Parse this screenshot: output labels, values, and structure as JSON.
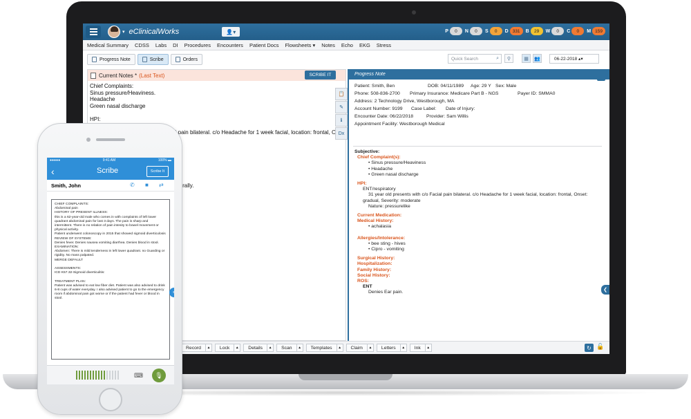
{
  "app": {
    "brand": "eClinicalWorks"
  },
  "counters": [
    {
      "label": "P",
      "value": "0",
      "color": "#d9d9d9"
    },
    {
      "label": "N",
      "value": "0",
      "color": "#d9d9d9"
    },
    {
      "label": "S",
      "value": "0",
      "color": "#f2a33a"
    },
    {
      "label": "D",
      "value": "331",
      "color": "#f07a33"
    },
    {
      "label": "B",
      "value": "29",
      "color": "#f1c232"
    },
    {
      "label": "W",
      "value": "0",
      "color": "#d9d9d9"
    },
    {
      "label": "C",
      "value": "0",
      "color": "#f07a33"
    },
    {
      "label": "M",
      "value": "159",
      "color": "#f07a33"
    }
  ],
  "nav": [
    "Medical Summary",
    "CDSS",
    "Labs",
    "DI",
    "Procedures",
    "Encounters",
    "Patient Docs",
    "Flowsheets ▾",
    "Notes",
    "Echo",
    "EKG",
    "Stress"
  ],
  "toolbar": {
    "progress_note": "Progress Note",
    "scribe": "Scribe",
    "orders": "Orders",
    "search_placeholder": "Quick Search",
    "date": "06-22-2018 ▴▾"
  },
  "current_notes": {
    "title": "Current Notes *",
    "status": "(Last Text)",
    "scribe_button": "SCRIBE IT",
    "text": "Chief Complaints:\nSinus pressure/Heaviness.\nHeadache\nGreen nasal discharge\n\nHPI:\nENT/Respiratory:\n31 year old presents with c/o Facial pain bilateral. c/o Headache for 1 week facial, location: frontal, Ons\n\n\nthroat.\n\n\n\n\nly, tympanic membranes normal bilaterally.\n\n\nterally."
  },
  "side_tools": [
    "📋",
    "✎",
    "ℹ",
    "Dx"
  ],
  "progress_note": {
    "header": "Progress Note",
    "patient": "Patient: Smith, Ben",
    "dob": "DOB: 04/11/1989",
    "age": "Age: 29 Y",
    "sex": "Sex: Male",
    "phone": "Phone: 508-836-2700",
    "insurance": "Primary Insurance: Medicare Part B - NGS",
    "payer": "Payer ID: SMMA0",
    "address": "Address: 2 Technology Drive, Westborough, MA",
    "account": "Account Number: 9199",
    "case_label": "Case Label:",
    "date_of_injury": "Date of Injury:",
    "encounter_date": "Encounter Date: 06/22/2018",
    "provider": "Provider: Sam Willis",
    "facility": "Appointment Facility: Westborough Medical",
    "subjective": "Subjective:",
    "chief_complaints": "Chief Complaint(s):",
    "cc_items": [
      "• Sinus pressure/Heaviness",
      "• Headache",
      "• Green nasal discharge"
    ],
    "hpi": "HPI:",
    "ent": "ENT/respiratory",
    "hpi_text": "31 year old presents with c/o Facial pain bilateral. c/o Headache for 1 week facial, location: frontal, Onset:",
    "hpi_text2": "gradual, Severity: moderate",
    "nature": "Nature: pressurelike",
    "current_medication": "Current Medication:",
    "medical_history": "Medical History:",
    "mh_item": "• achalasia",
    "allergies": "Allergies/Intolerance:",
    "allergy_items": [
      "• bee sting - hives",
      "• Cipro - vomiting"
    ],
    "surgical_history": "Surgical History:",
    "hospitalization": "Hospitalization:",
    "family_history": "Family History:",
    "social_history": "Social History:",
    "ros": "ROS:",
    "ros_ent": "ENT",
    "ros_text": "Denies Ear pain."
  },
  "bottom_bar": [
    "Record",
    "Lock",
    "Details",
    "Scan",
    "Templates",
    "Claim",
    "Letters",
    "Ink"
  ],
  "phone": {
    "time": "9:41 AM",
    "carrier": "●●●●● ",
    "battery": "100% ▬",
    "title": "Scribe",
    "scribe_button": "Scribe It",
    "patient": "Smith, John",
    "note": "CHIEF COMPLAINTS:\nAbdominal pain\nHISTORY OF PRESENT ILLNESS:\nthis is a 62-year-old male who comes in with complaints of left lower quadrant abdominal pain for last 3 days. The pain is sharp and intermittent. There is no relation of pain intesity to bowel movement or physical activity.\nPatient underwent colonoscopy in 2015 that showed sigmoid diverticulosis\nREVIEW OF SYSTEMS:\nDenies fever. Denies nausea vomiting diarrhea. Denies blood in stool.\nEXAMINATION:\nAbdomen: There is mild tenderness in left lower quadrant. no Guarding or rigidity. No mass palpated.\nMERGE DEFAULT\n\nASSESSMENTS:\nICD K57.32-Sigmoid diverticulitis:\n\nTREATMENT PLAN:\nPatient was advised to eat low fiber diet. Patient was also advised to drink 6-8 cups of water everyday. I also advised patient to go to the emergency room if abdominal pain got worse or if the patient had fever or blood in stool."
  }
}
